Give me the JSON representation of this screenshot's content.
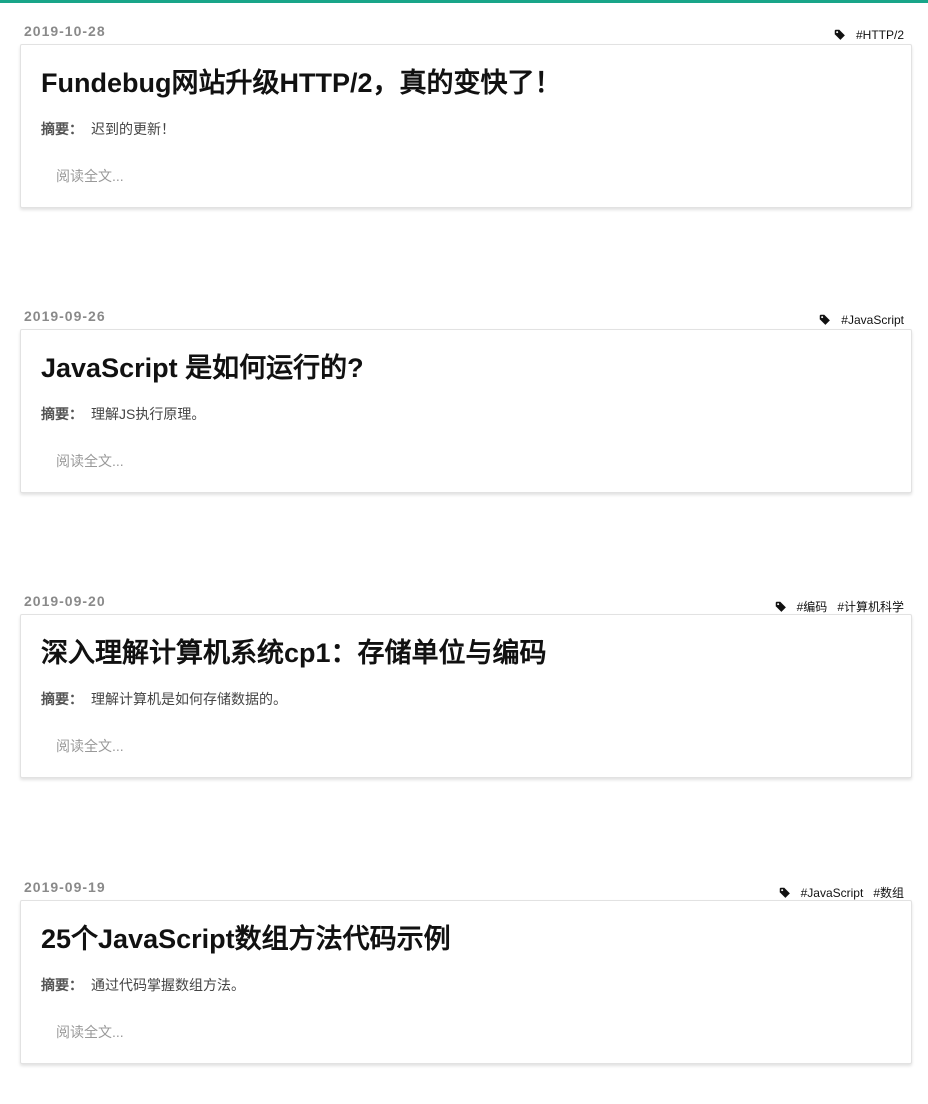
{
  "accent_color": "#18a589",
  "posts": [
    {
      "date": "2019-10-28",
      "tags": [
        "#HTTP/2"
      ],
      "title": "Fundebug网站升级HTTP/2，真的变快了！",
      "summary_label": "摘要：",
      "summary": "迟到的更新！",
      "read_more": "阅读全文..."
    },
    {
      "date": "2019-09-26",
      "tags": [
        "#JavaScript"
      ],
      "title": "JavaScript 是如何运行的?",
      "summary_label": "摘要：",
      "summary": "理解JS执行原理。",
      "read_more": "阅读全文..."
    },
    {
      "date": "2019-09-20",
      "tags": [
        "#编码",
        "#计算机科学"
      ],
      "title": "深入理解计算机系统cp1：存储单位与编码",
      "summary_label": "摘要：",
      "summary": "理解计算机是如何存储数据的。",
      "read_more": "阅读全文..."
    },
    {
      "date": "2019-09-19",
      "tags": [
        "#JavaScript",
        "#数组"
      ],
      "title": "25个JavaScript数组方法代码示例",
      "summary_label": "摘要：",
      "summary": "通过代码掌握数组方法。",
      "read_more": "阅读全文..."
    }
  ]
}
